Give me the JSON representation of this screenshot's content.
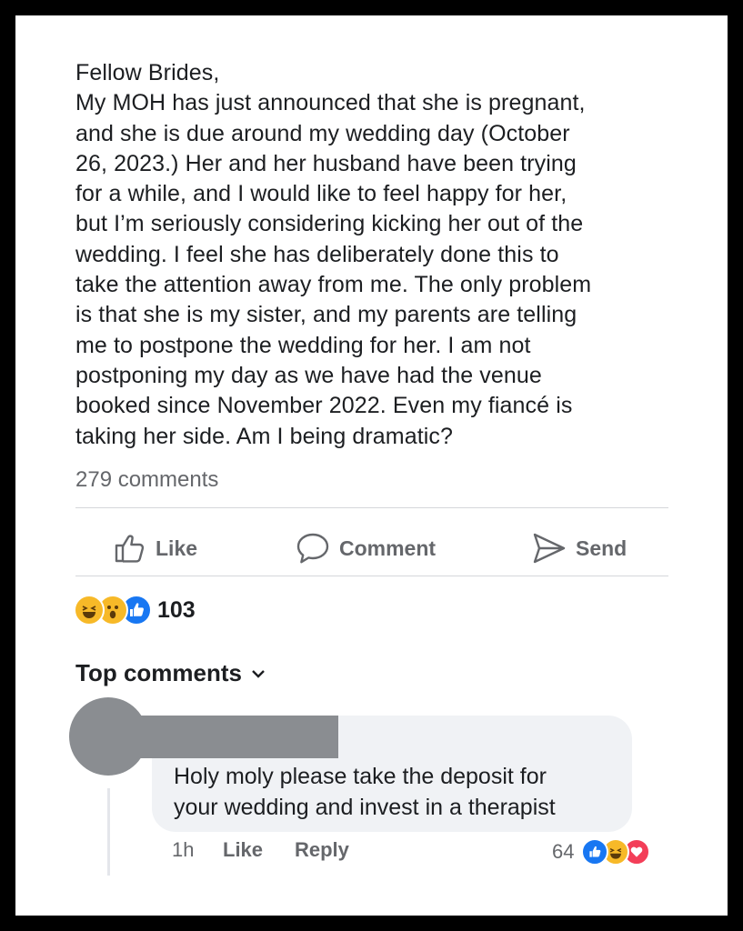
{
  "post": {
    "lines": [
      "Fellow Brides,",
      "My MOH has just announced that she is pregnant,",
      "and she is due around my wedding day (October",
      "26, 2023.) Her and her husband have been trying",
      "for a while, and I would like to feel happy for her,",
      "but I’m seriously considering kicking her out of the",
      "wedding. I feel she has deliberately done this to",
      "take the attention away from me. The only problem",
      "is that she is my sister, and my parents are telling",
      "me to postpone the wedding for her. I am not",
      "postponing my day as we have had the venue",
      "booked since November 2022. Even my fiancé is",
      "taking her side. Am I being dramatic?"
    ],
    "comments_count": "279 comments"
  },
  "actions": {
    "like": "Like",
    "comment": "Comment",
    "send": "Send"
  },
  "reactions": {
    "icons": [
      "haha-icon",
      "wow-icon",
      "like-icon"
    ],
    "count": "103"
  },
  "top_comments": {
    "label": "Top comments"
  },
  "comment": {
    "lines": [
      "Holy moly please take the deposit for",
      "your wedding and invest in a therapist"
    ],
    "time": "1h",
    "like_label": "Like",
    "reply_label": "Reply",
    "reaction_count": "64",
    "reaction_icons": [
      "like-icon",
      "haha-icon",
      "love-icon"
    ]
  },
  "colors": {
    "like_blue": "#1877f2",
    "haha_yellow": "#f7b928",
    "love_red": "#f33e58",
    "muted_text": "#65676b"
  }
}
